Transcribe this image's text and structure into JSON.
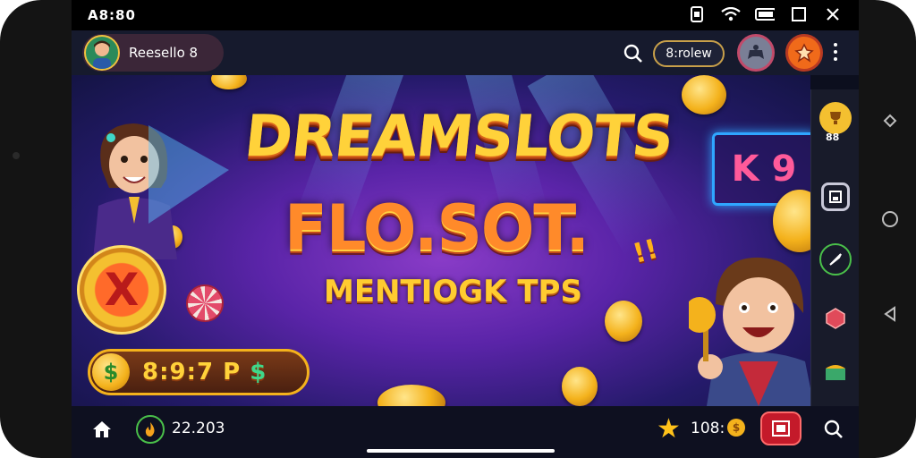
{
  "status_bar": {
    "time": "A8:80"
  },
  "top_bar": {
    "profile_name": "Reesello 8",
    "review_button": "8:rolew"
  },
  "banner": {
    "title_line1": "DREAMSLOTS",
    "title_line2": "FLO.SOT.",
    "title_line3": "MENTIOGK TPS",
    "exclaim": "!!",
    "neon_sign": "K 9",
    "wallet_value_gold": "8:9:7 P",
    "wallet_value_green": "$",
    "wallet_coin_symbol": "$",
    "big_coin_symbol": "X"
  },
  "side_rail": {
    "count": "88"
  },
  "bottom_bar": {
    "balance": "22.203",
    "points": "108:",
    "points_coin": "$"
  },
  "colors": {
    "accent_gold": "#ffd23a",
    "accent_orange": "#f06a1a",
    "accent_green": "#3fd88a",
    "danger_red": "#c41a2a"
  },
  "icons": [
    "wifi-icon",
    "battery-icon",
    "search-icon",
    "more-icon",
    "home-icon",
    "star-icon",
    "gift-icon",
    "back-icon",
    "home-nav-icon",
    "recent-icon"
  ]
}
